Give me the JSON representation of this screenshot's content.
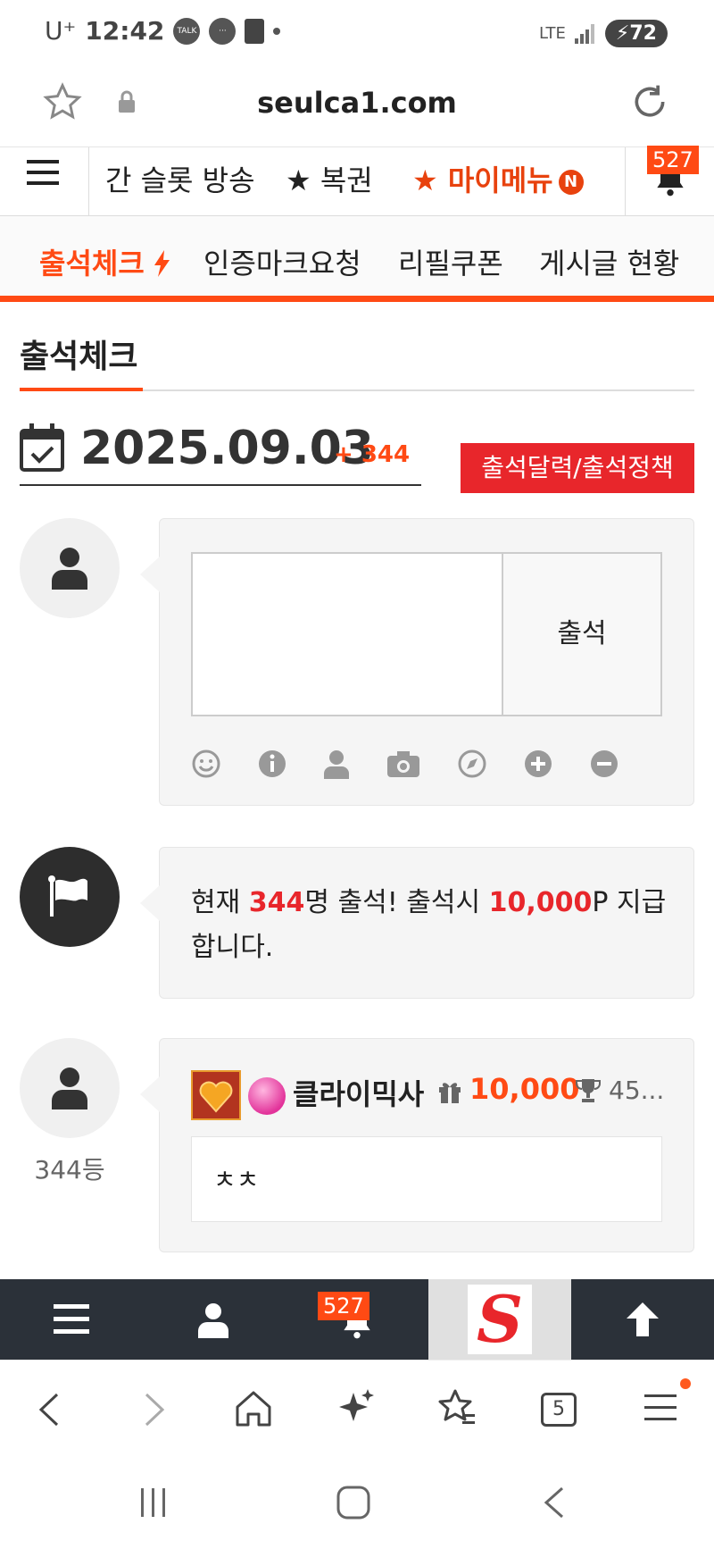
{
  "status_bar": {
    "carrier": "U⁺",
    "time": "12:42",
    "talk_icon_label": "TALK",
    "network": "LTE",
    "battery": "72"
  },
  "address_bar": {
    "url": "seulca1.com"
  },
  "site_nav": {
    "items": [
      "간 슬롯 방송",
      "★ 복권",
      "★ 마이메뉴"
    ],
    "mymenu_badge": "N",
    "notification_count": "527"
  },
  "tabs": [
    {
      "label": "출석체크",
      "active": true
    },
    {
      "label": "인증마크요청",
      "active": false
    },
    {
      "label": "리필쿠폰",
      "active": false
    },
    {
      "label": "게시글 현황",
      "active": false
    }
  ],
  "page": {
    "title": "출석체크",
    "date": "2025.09.03",
    "date_count": "+ 344",
    "calendar_button": "출석달력/출석정책"
  },
  "attendance_form": {
    "textarea_value": "",
    "submit_label": "출석"
  },
  "notice": {
    "prefix": "현재 ",
    "count": "344",
    "mid": "명 출석! 출석시 ",
    "points": "10,000",
    "suffix": "P 지급합니다."
  },
  "entry": {
    "rank": "344등",
    "username": "클라이믹사",
    "points": "10,000",
    "trophy_value": "45...",
    "comment": "ㅊㅊ"
  },
  "bottom_bar": {
    "notification_count": "527",
    "logo_letter": "S"
  },
  "browser_nav": {
    "tab_count": "5"
  },
  "colors": {
    "accent": "#ff4a14",
    "red": "#e8262b",
    "dark_bar": "#2b3139"
  }
}
